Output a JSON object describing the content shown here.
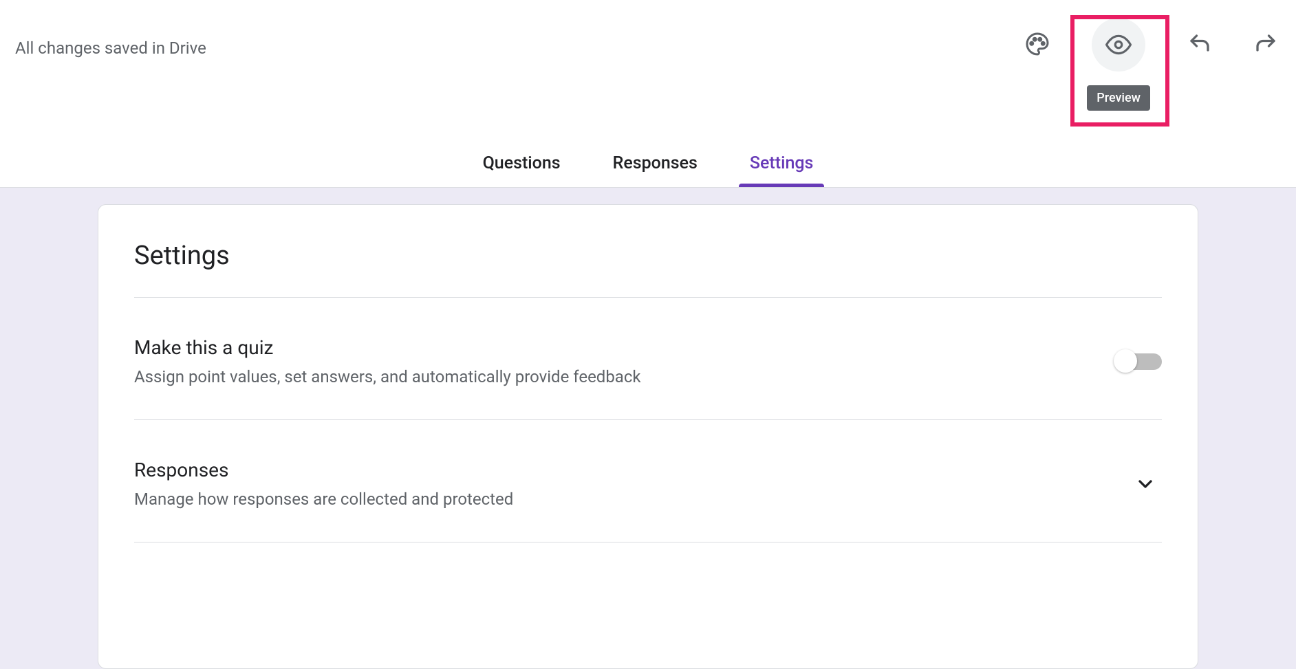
{
  "header": {
    "save_status": "All changes saved in Drive",
    "preview_tooltip": "Preview"
  },
  "tabs": {
    "questions": "Questions",
    "responses": "Responses",
    "settings": "Settings"
  },
  "settings": {
    "title": "Settings",
    "quiz": {
      "title": "Make this a quiz",
      "description": "Assign point values, set answers, and automatically provide feedback"
    },
    "responses": {
      "title": "Responses",
      "description": "Manage how responses are collected and protected"
    }
  }
}
